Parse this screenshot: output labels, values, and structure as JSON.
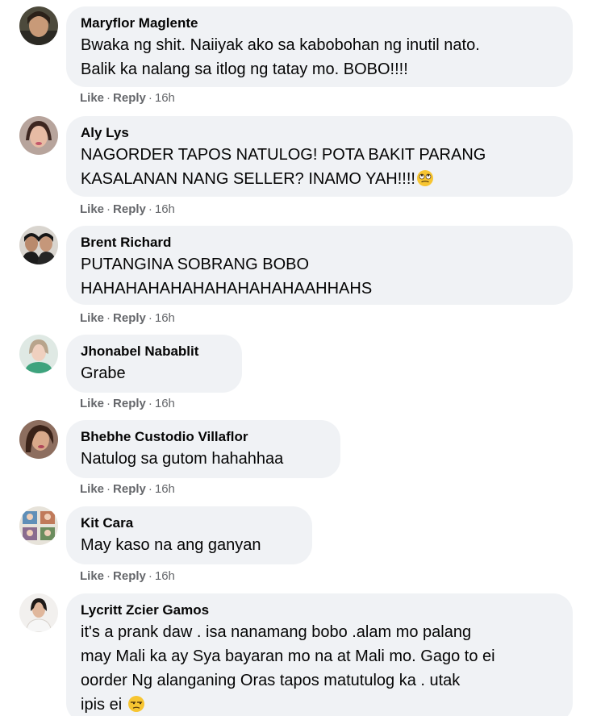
{
  "actions": {
    "like_label": "Like",
    "reply_label": "Reply",
    "separator": "·"
  },
  "comments": [
    {
      "author": "Maryflor Maglente",
      "text": "Bwaka ng shit. Naiiyak ako sa kabobohan ng inutil nato.\nBalik ka nalang sa itlog ng tatay mo. BOBO!!!!",
      "time": "16h"
    },
    {
      "author": "Aly Lys",
      "text": "NAGORDER TAPOS NATULOG! POTA BAKIT PARANG\nKASALANAN NANG SELLER? INAMO YAH!!!!",
      "emoji": "face-with-rolling-eyes-emoji",
      "time": "16h"
    },
    {
      "author": "Brent Richard",
      "text": "PUTANGINA SOBRANG BOBO\nHAHAHAHAHAHAHAHAHAHAAHHAHS",
      "time": "16h"
    },
    {
      "author": "Jhonabel Nabablit",
      "text": "Grabe",
      "time": "16h"
    },
    {
      "author": "Bhebhe Custodio Villaflor",
      "text": "Natulog sa gutom hahahhaa",
      "time": "16h"
    },
    {
      "author": "Kit Cara",
      "text": "May kaso na ang ganyan",
      "time": "16h"
    },
    {
      "author": "Lycritt Zcier Gamos",
      "text": "it's a prank daw . isa nanamang bobo .alam mo palang\nmay Mali ka ay Sya bayaran mo na at Mali mo. Gago to ei\noorder Ng alanganing Oras tapos matutulog ka . utak\nipis ei",
      "emoji": "unamused-face-emoji"
    }
  ],
  "colors": {
    "bubble_background": "#f0f2f5",
    "text": "#050505",
    "meta_text": "#65676b",
    "emoji_yellow": "#f7c531"
  }
}
